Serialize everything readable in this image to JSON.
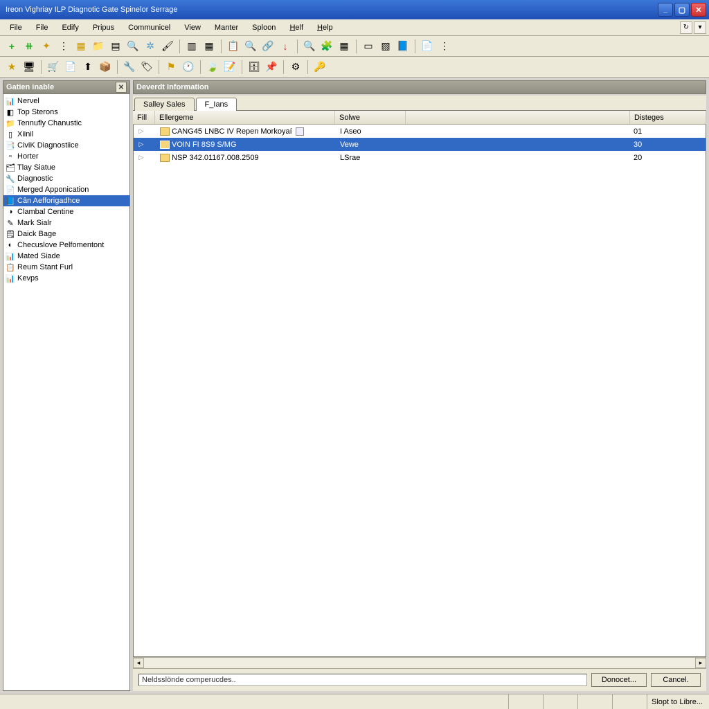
{
  "window": {
    "title": "Ireon Vighriay ILP Diagnotic Gate Spinelor Serrage"
  },
  "menubar": {
    "items": [
      "File",
      "File",
      "Edify",
      "Pripus",
      "Communicel",
      "View",
      "Manter",
      "Sploon"
    ],
    "help1": "H",
    "help1b": "elf",
    "help2": "H",
    "help2b": "elp"
  },
  "sidebar": {
    "title": "Gatien inable",
    "items": [
      {
        "label": "Nervel",
        "icon": "📊"
      },
      {
        "label": "Top Sterons",
        "icon": "◧"
      },
      {
        "label": "Tennufly Chanustic",
        "icon": "📁"
      },
      {
        "label": "Xiinil",
        "icon": "▯"
      },
      {
        "label": "CiviK Diagnostiice",
        "icon": "📑"
      },
      {
        "label": "Horter",
        "icon": "▫"
      },
      {
        "label": "Tlay Siatue",
        "icon": "🗂"
      },
      {
        "label": "Diagnostic",
        "icon": "🔧"
      },
      {
        "label": "Merged Apponication",
        "icon": "📄"
      },
      {
        "label": "Cân Aefforigadhce",
        "icon": "📘",
        "selected": true
      },
      {
        "label": "Clambal Centine",
        "icon": "◑"
      },
      {
        "label": "Mark Sialr",
        "icon": "✎"
      },
      {
        "label": "Daick Bage",
        "icon": "🗒"
      },
      {
        "label": "Checuslove Pelfomentont",
        "icon": "◐"
      },
      {
        "label": "Mated Siade",
        "icon": "📊"
      },
      {
        "label": "Reum Stant Furl",
        "icon": "📋"
      },
      {
        "label": "Kevps",
        "icon": "📊"
      }
    ]
  },
  "main": {
    "panel_title": "Deverdt Information",
    "tabs": [
      {
        "label": "Salley Sales",
        "active": false
      },
      {
        "label": "F_Ians",
        "active": true
      }
    ],
    "columns": [
      "Fill",
      "Ellergeme",
      "",
      "Solwe",
      "Disteges"
    ],
    "rows": [
      {
        "name": "CANG45 LNBC IV Repen Morkoyaí",
        "solve": "I Aseo",
        "dist": "01",
        "selected": false,
        "badge": true
      },
      {
        "name": "VOIN FI 8S9 S/MG",
        "solve": "Vewe",
        "dist": "30",
        "selected": true
      },
      {
        "name": "NSP 342.01167.008.2509",
        "solve": "LSrae",
        "dist": "20",
        "selected": false
      }
    ]
  },
  "bottom": {
    "status_text": "Neldsslönde comperucdes..",
    "btn1": "Donocet...",
    "btn2": "Cancel."
  },
  "statusbar": {
    "right": "Slopt to Libre..."
  }
}
